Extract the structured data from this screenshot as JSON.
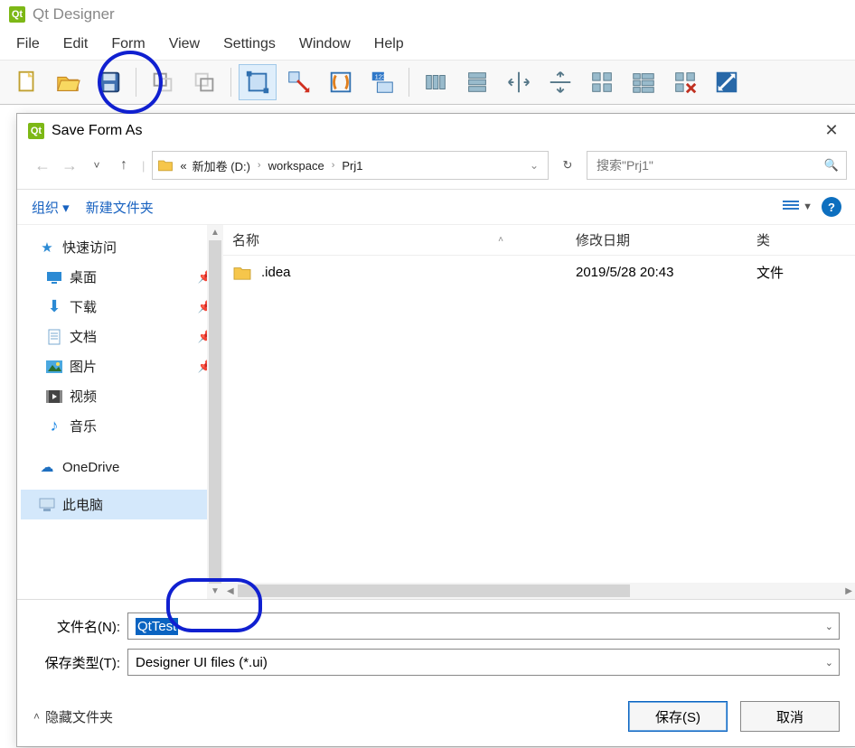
{
  "app": {
    "title": "Qt Designer"
  },
  "menu": {
    "file": "File",
    "edit": "Edit",
    "form": "Form",
    "view": "View",
    "settings": "Settings",
    "window": "Window",
    "help": "Help"
  },
  "dialog": {
    "title": "Save Form As",
    "path": {
      "prefix": "«",
      "segments": [
        "新加卷 (D:)",
        "workspace",
        "Prj1"
      ]
    },
    "search_placeholder": "搜索\"Prj1\"",
    "organize": "组织",
    "new_folder": "新建文件夹",
    "columns": {
      "name": "名称",
      "date": "修改日期",
      "type": "类"
    },
    "rows": [
      {
        "name": ".idea",
        "date": "2019/5/28 20:43",
        "type": "文件"
      }
    ],
    "sidebar": {
      "quick_access": "快速访问",
      "desktop": "桌面",
      "downloads": "下载",
      "documents": "文档",
      "pictures": "图片",
      "videos": "视频",
      "music": "音乐",
      "onedrive": "OneDrive",
      "this_pc": "此电脑"
    },
    "filename_label": "文件名(N):",
    "filename_value": "QtTest",
    "filetype_label": "保存类型(T):",
    "filetype_value": "Designer UI files (*.ui)",
    "hidden_folders": "隐藏文件夹",
    "save_btn": "保存(S)",
    "cancel_btn": "取消"
  }
}
